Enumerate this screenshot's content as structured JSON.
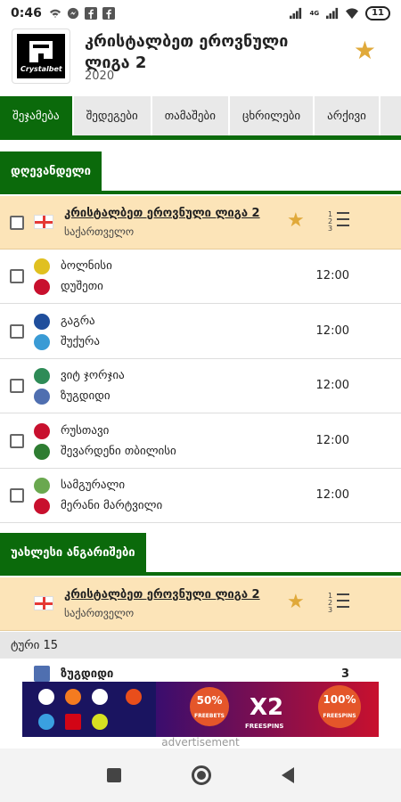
{
  "status": {
    "time": "0:46",
    "battery": "11",
    "network_label": "4G"
  },
  "header": {
    "title": "კრისტალბეთ ეროვნული ლიგა 2",
    "year": "2020",
    "logo_text": "Crystalbet"
  },
  "tabs": [
    {
      "label": "შეჯამება",
      "active": true
    },
    {
      "label": "შედეგები"
    },
    {
      "label": "თამაშები"
    },
    {
      "label": "ცხრილები"
    },
    {
      "label": "არქივი"
    }
  ],
  "today": {
    "section_label": "დღევანდელი",
    "league": {
      "name": "კრისტალბეთ ეროვნული ლიგა 2",
      "country": "საქართველო"
    },
    "matches": [
      {
        "home": "ბოლნისი",
        "away": "დუშეთი",
        "time": "12:00",
        "home_color": "#e0c020",
        "away_color": "#c8102e"
      },
      {
        "home": "გაგრა",
        "away": "შუქურა",
        "time": "12:00",
        "home_color": "#1f4e9c",
        "away_color": "#3a9bd5"
      },
      {
        "home": "ვიტ ჯორჯია",
        "away": "ზუგდიდი",
        "time": "12:00",
        "home_color": "#2e8b57",
        "away_color": "#4f6fb0"
      },
      {
        "home": "რუსთავი",
        "away": "შევარდენი თბილისი",
        "time": "12:00",
        "home_color": "#c8102e",
        "away_color": "#2e7d32"
      },
      {
        "home": "სამგურალი",
        "away": "მერანი მარტვილი",
        "time": "12:00",
        "home_color": "#6aa84f",
        "away_color": "#c8102e"
      }
    ]
  },
  "recent": {
    "section_label": "უახლესი ანგარიშები",
    "league": {
      "name": "კრისტალბეთ ეროვნული ლიგა 2",
      "country": "საქართველო"
    },
    "round_label": "ტური 15",
    "first_result": {
      "team": "ზუგდიდი",
      "score": "3"
    }
  },
  "standings_icon_nums": [
    "1",
    "2",
    "3"
  ],
  "ad": {
    "label": "advertisement",
    "badge1": "50%",
    "badge1_sub": "FREEBETS",
    "main": "X2",
    "main_sub": "FREESPINS",
    "badge2": "100%",
    "badge2_sub": "FREESPINS"
  },
  "colors": {
    "brand_green": "#0b6a0b",
    "league_bg": "#fce4b8",
    "star": "#e0a93a"
  }
}
